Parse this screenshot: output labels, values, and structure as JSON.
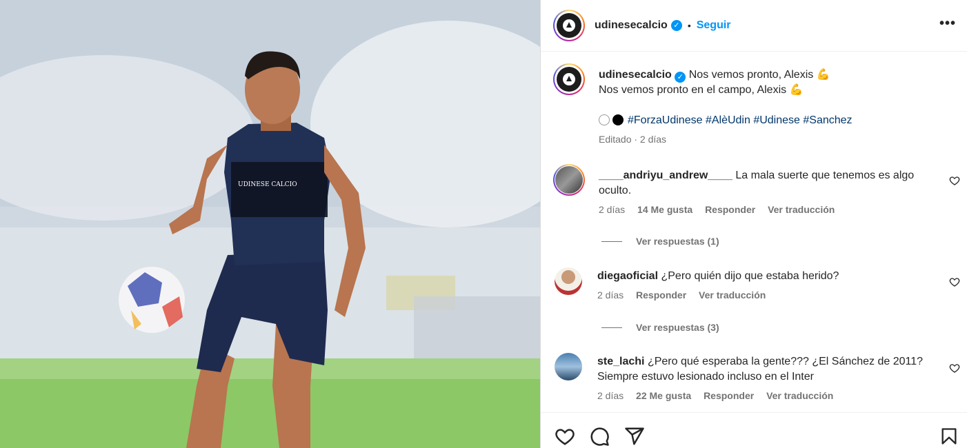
{
  "post": {
    "username": "udinesecalcio",
    "follow_label": "Seguir",
    "separator": "•",
    "more_label": "•••",
    "caption_line1": "Nos vemos pronto, Alexis 💪",
    "caption_line2": "Nos vemos pronto en el campo, Alexis 💪",
    "hashtags": "#ForzaUdinese #AlèUdin #Udinese #Sanchez",
    "edited_meta": "Editado · 2 días",
    "jersey_text": "UDINESE CALCIO"
  },
  "comments": [
    {
      "username": "____andriyu_andrew____",
      "text": "La mala suerte que tenemos es algo",
      "text2": "oculto.",
      "time": "2 días",
      "likes": "14 Me gusta",
      "reply": "Responder",
      "translate": "Ver traducción",
      "view_replies": "Ver respuestas (1)"
    },
    {
      "username": "diegaoficial",
      "text": "¿Pero quién dijo que estaba herido?",
      "time": "2 días",
      "reply": "Responder",
      "translate": "Ver traducción",
      "view_replies": "Ver respuestas (3)"
    },
    {
      "username": "ste_lachi",
      "text": "¿Pero qué esperaba la gente??? ¿El Sánchez de 2011?",
      "text2": "Siempre estuvo lesionado incluso en el Inter",
      "time": "2 días",
      "likes": "22 Me gusta",
      "reply": "Responder",
      "translate": "Ver traducción"
    }
  ],
  "icons": {
    "verified": "verified-badge-icon",
    "heart": "heart-icon",
    "comment": "comment-icon",
    "share": "share-icon",
    "save": "bookmark-icon"
  },
  "colors": {
    "accent": "#0095f6",
    "hashtag": "#00376b",
    "muted": "#737373"
  }
}
